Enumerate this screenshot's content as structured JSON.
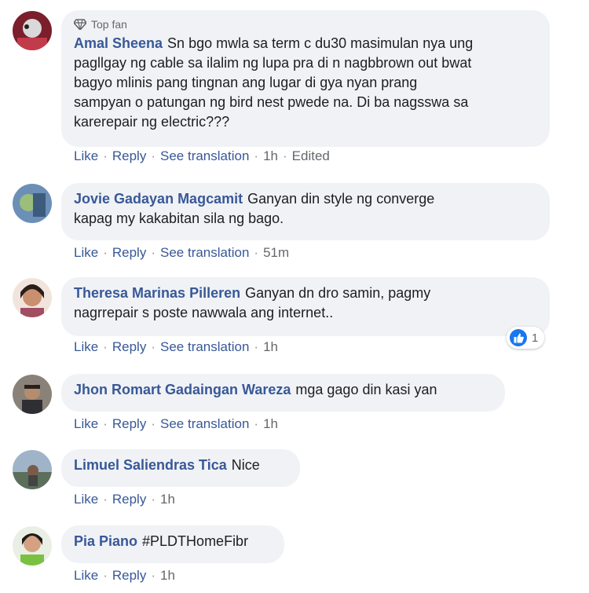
{
  "comments": [
    {
      "badge": "Top fan",
      "name": "Amal Sheena",
      "text": "Sn bgo mwla sa term c du30 masimulan nya ung\npagllgay ng cable sa ilalim ng lupa pra di n nagbbrown out bwat\nbagyo mlinis pang tingnan ang lugar di gya nyan prang\nsampyan o patungan ng bird nest pwede na. Di ba nagsswa sa\nkarerepair ng electric???",
      "actions": [
        "Like",
        "Reply",
        "See translation"
      ],
      "time": "1h",
      "edited": "Edited",
      "avatar_icon": "user-avatar"
    },
    {
      "name": "Jovie Gadayan Magcamit",
      "text": "Ganyan din style ng converge\nkapag my kakabitan sila ng bago.",
      "actions": [
        "Like",
        "Reply",
        "See translation"
      ],
      "time": "51m",
      "avatar_icon": "user-avatar"
    },
    {
      "name": "Theresa Marinas Pilleren",
      "text": "Ganyan dn dro samin, pagmy\nnagrrepair s poste nawwala ang internet..",
      "actions": [
        "Like",
        "Reply",
        "See translation"
      ],
      "time": "1h",
      "reaction_count": "1",
      "avatar_icon": "user-avatar"
    },
    {
      "name": "Jhon Romart Gadaingan Wareza",
      "text": "mga gago din kasi yan",
      "actions": [
        "Like",
        "Reply",
        "See translation"
      ],
      "time": "1h",
      "avatar_icon": "user-avatar"
    },
    {
      "name": "Limuel Saliendras Tica",
      "text": "Nice",
      "actions": [
        "Like",
        "Reply"
      ],
      "time": "1h",
      "avatar_icon": "user-avatar"
    },
    {
      "name": "Pia Piano",
      "text": "#PLDTHomeFibr",
      "actions": [
        "Like",
        "Reply"
      ],
      "time": "1h",
      "avatar_icon": "user-avatar"
    }
  ],
  "colors": {
    "name": "#385898",
    "bubble": "#f0f2f5",
    "meta": "#65676b",
    "like_blue": "#1877f2"
  }
}
